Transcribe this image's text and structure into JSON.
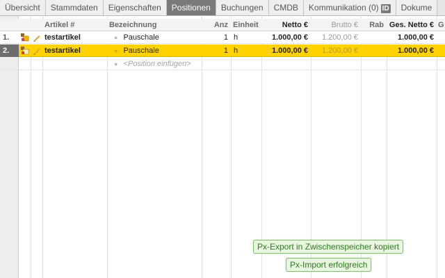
{
  "tabs": [
    {
      "label": "Übersicht",
      "active": false
    },
    {
      "label": "Stammdaten",
      "active": false
    },
    {
      "label": "Eigenschaften",
      "active": false
    },
    {
      "label": "Positionen",
      "active": true
    },
    {
      "label": "Buchungen",
      "active": false
    },
    {
      "label": "CMDB",
      "active": false
    },
    {
      "label": "Kommunikation (0)",
      "active": false,
      "badge": "ID"
    },
    {
      "label": "Dokume",
      "active": false
    }
  ],
  "columns": {
    "artikel": "Artikel #",
    "bezeichnung": "Bezeichnung",
    "anz": "Anz",
    "einheit": "Einheit",
    "netto": "Netto €",
    "brutto": "Brutto €",
    "rab": "Rab",
    "ges_netto": "Ges. Netto €",
    "extra": "G"
  },
  "rows": [
    {
      "num": "1.",
      "artikel": "testartikel",
      "bezeichnung": "Pauschale",
      "anz": "1",
      "einheit": "h",
      "netto": "1.000,00 €",
      "brutto": "1.200,00 €",
      "rab": "",
      "ges_netto": "1.000,00 €"
    },
    {
      "num": "2.",
      "artikel": "testartikel",
      "bezeichnung": "Pauschale",
      "anz": "1",
      "einheit": "h",
      "netto": "1.000,00 €",
      "brutto": "1.200,00 €",
      "rab": "",
      "ges_netto": "1.000,00 €"
    }
  ],
  "insert_row": {
    "placeholder": "<Position einfügen>"
  },
  "toasts": [
    {
      "text": "Px-Export in Zwischenspeicher kopiert"
    },
    {
      "text": "Px-Import erfolgreich"
    }
  ],
  "colors": {
    "selected_row": "#ffd200",
    "active_tab": "#7a7a7a",
    "toast_bg": "#e9f7e1",
    "toast_border": "#7fbf6a"
  }
}
